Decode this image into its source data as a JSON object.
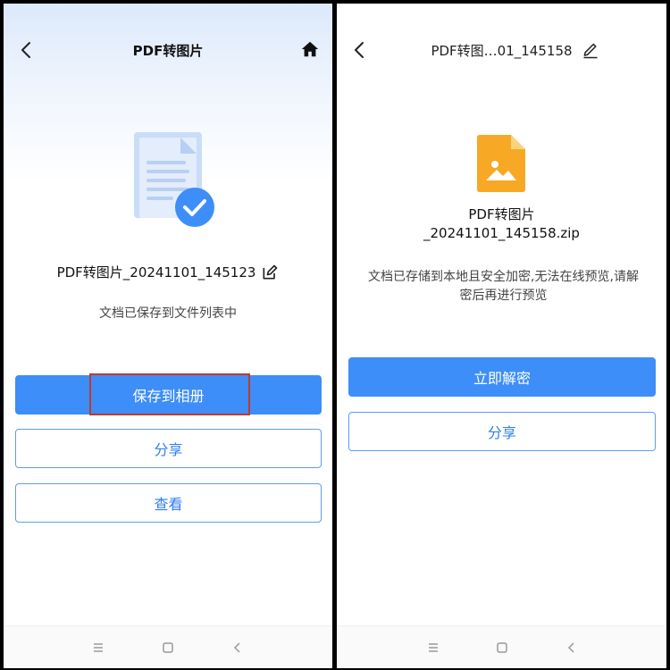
{
  "left_screen": {
    "nav": {
      "title": "PDF转图片"
    },
    "file_name": "PDF转图片_20241101_145123",
    "status": "文档已保存到文件列表中",
    "buttons": {
      "save_to_album": "保存到相册",
      "share": "分享",
      "view": "查看"
    }
  },
  "right_screen": {
    "nav": {
      "title": "PDF转图…01_145158"
    },
    "file_name_line1": "PDF转图片",
    "file_name_line2": "_20241101_145158.zip",
    "secure_text_line1": "文档已存储到本地且安全加密,无法在线预览,请解",
    "secure_text_line2": "密后再进行预览",
    "buttons": {
      "decrypt_now": "立即解密",
      "share": "分享"
    }
  },
  "colors": {
    "primary_blue": "#3d8ef8",
    "outline_blue": "#5b9cf3",
    "highlight_red": "#c0392b",
    "zip_orange": "#f7a825"
  },
  "icons": {
    "back": "chevron-left-icon",
    "home": "home-icon",
    "edit": "edit-icon",
    "menu": "menu-icon",
    "recent": "square-icon",
    "system_back": "chevron-left-icon"
  }
}
